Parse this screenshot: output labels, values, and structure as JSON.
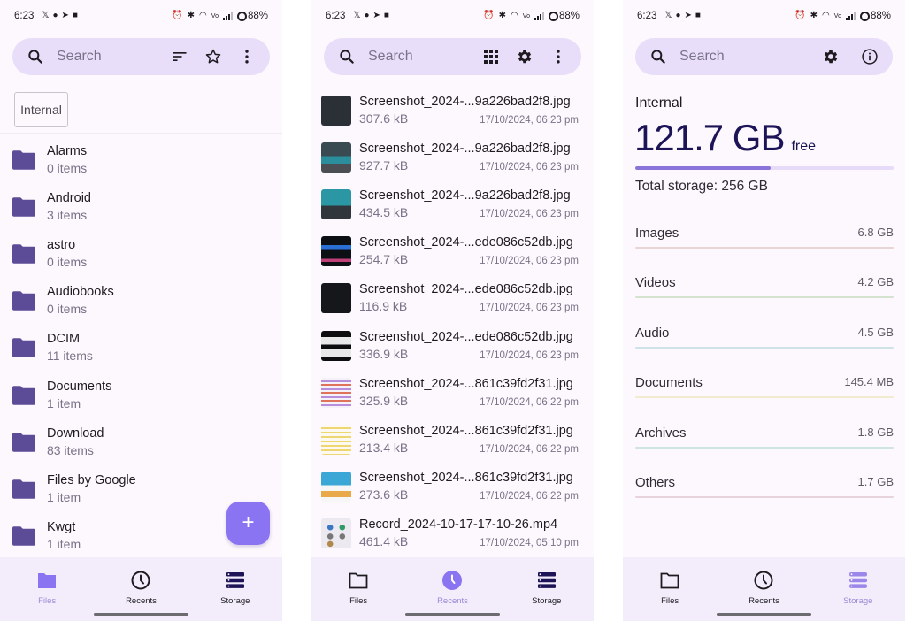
{
  "status_bar": {
    "time": "6:23",
    "left_icons": [
      "x-icon",
      "notification-dot-icon",
      "telegram-icon",
      "bag-icon"
    ],
    "right_icons": [
      "alarm-icon",
      "bluetooth-icon",
      "wifi-icon",
      "volte-icon",
      "signal-icon"
    ],
    "battery": "88%"
  },
  "panels": {
    "files": {
      "search": {
        "placeholder": "Search"
      },
      "actions": [
        "sort-icon",
        "star-icon",
        "more-vert-icon"
      ],
      "chip": "Internal",
      "folders": [
        {
          "name": "Alarms",
          "count": "0 items"
        },
        {
          "name": "Android",
          "count": "3 items"
        },
        {
          "name": "astro",
          "count": "0 items"
        },
        {
          "name": "Audiobooks",
          "count": "0 items"
        },
        {
          "name": "DCIM",
          "count": "11 items"
        },
        {
          "name": "Documents",
          "count": "1 item"
        },
        {
          "name": "Download",
          "count": "83 items"
        },
        {
          "name": "Files by Google",
          "count": "1 item"
        },
        {
          "name": "Kwgt",
          "count": "1 item"
        }
      ],
      "fab_label": "+"
    },
    "recents": {
      "search": {
        "placeholder": "Search"
      },
      "actions": [
        "grid-icon",
        "gear-icon",
        "more-vert-icon"
      ],
      "files": [
        {
          "name": "Screenshot_2024-...9a226bad2f8.jpg",
          "size": "307.6 kB",
          "date": "17/10/2024, 06:23 pm",
          "thumb": "dark-list"
        },
        {
          "name": "Screenshot_2024-...9a226bad2f8.jpg",
          "size": "927.7 kB",
          "date": "17/10/2024, 06:23 pm",
          "thumb": "photo-grid"
        },
        {
          "name": "Screenshot_2024-...9a226bad2f8.jpg",
          "size": "434.5 kB",
          "date": "17/10/2024, 06:23 pm",
          "thumb": "teal-card"
        },
        {
          "name": "Screenshot_2024-...ede086c52db.jpg",
          "size": "254.7 kB",
          "date": "17/10/2024, 06:23 pm",
          "thumb": "black-blue"
        },
        {
          "name": "Screenshot_2024-...ede086c52db.jpg",
          "size": "116.9 kB",
          "date": "17/10/2024, 06:23 pm",
          "thumb": "black-plain"
        },
        {
          "name": "Screenshot_2024-...ede086c52db.jpg",
          "size": "336.9 kB",
          "date": "17/10/2024, 06:23 pm",
          "thumb": "black-white"
        },
        {
          "name": "Screenshot_2024-...861c39fd2f31.jpg",
          "size": "325.9 kB",
          "date": "17/10/2024, 06:22 pm",
          "thumb": "light-colorful"
        },
        {
          "name": "Screenshot_2024-...861c39fd2f31.jpg",
          "size": "213.4 kB",
          "date": "17/10/2024, 06:22 pm",
          "thumb": "light-yellow"
        },
        {
          "name": "Screenshot_2024-...861c39fd2f31.jpg",
          "size": "273.6 kB",
          "date": "17/10/2024, 06:22 pm",
          "thumb": "blue-header"
        },
        {
          "name": "Record_2024-10-17-17-10-26.mp4",
          "size": "461.4 kB",
          "date": "17/10/2024, 05:10 pm",
          "thumb": "light-dots"
        }
      ]
    },
    "storage": {
      "search": {
        "placeholder": "Search"
      },
      "actions": [
        "gear-icon",
        "info-icon"
      ],
      "volume_label": "Internal",
      "free_value": "121.7 GB",
      "free_suffix": "free",
      "used_fraction": 0.525,
      "total": "Total storage: 256 GB",
      "categories": [
        {
          "name": "Images",
          "size": "6.8 GB",
          "color": "#e8d6d6"
        },
        {
          "name": "Videos",
          "size": "4.2 GB",
          "color": "#d3e3cf"
        },
        {
          "name": "Audio",
          "size": "4.5 GB",
          "color": "#cfe2e8"
        },
        {
          "name": "Documents",
          "size": "145.4 MB",
          "color": "#f1ecd0"
        },
        {
          "name": "Archives",
          "size": "1.8 GB",
          "color": "#cfe6e0"
        },
        {
          "name": "Others",
          "size": "1.7 GB",
          "color": "#e8d3dc"
        }
      ]
    }
  },
  "bottom_nav": {
    "items": [
      {
        "label": "Files",
        "icon": "folder-icon"
      },
      {
        "label": "Recents",
        "icon": "clock-icon"
      },
      {
        "label": "Storage",
        "icon": "storage-icon"
      }
    ]
  },
  "colors": {
    "accent": "#8b74f2",
    "folder": "#5c4b96",
    "search_bg": "#e8defa",
    "nav_bg": "#f3edfb",
    "active_label": "#9b8ad6"
  }
}
